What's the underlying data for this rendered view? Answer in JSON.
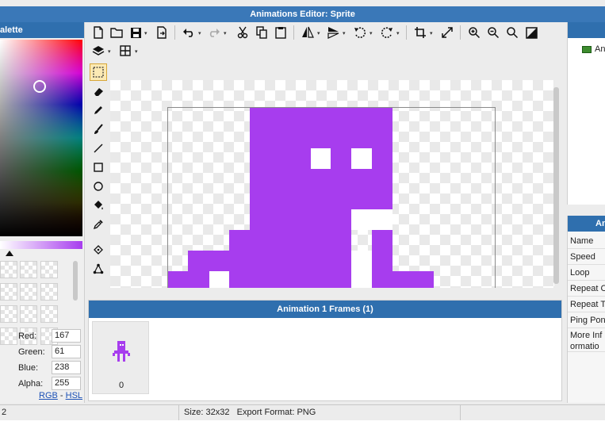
{
  "window": {
    "title": "Animations Editor: Sprite"
  },
  "palette": {
    "header": "alette",
    "color": {
      "red": "167",
      "green": "61",
      "blue": "238",
      "alpha": "255"
    },
    "labels": {
      "red": "Red:",
      "green": "Green:",
      "blue": "Blue:",
      "alpha": "Alpha:"
    },
    "modes": {
      "rgb": "RGB",
      "separator": " - ",
      "hsl": "HSL"
    },
    "current_color": "#a73dee"
  },
  "toolbar": {
    "icons": [
      "new-file-icon",
      "open-folder-icon",
      "save-icon",
      "export-icon",
      "undo-icon",
      "redo-icon",
      "cut-icon",
      "copy-icon",
      "paste-icon",
      "flip-horizontal-icon",
      "flip-vertical-icon",
      "rotate-left-icon",
      "rotate-right-icon",
      "crop-icon",
      "resize-icon",
      "zoom-in-icon",
      "zoom-out-icon",
      "zoom-fit-icon",
      "fill-screen-icon",
      "layers-icon",
      "grid-icon"
    ]
  },
  "tools": [
    "select-rectangle-icon",
    "eraser-icon",
    "pencil-icon",
    "brush-icon",
    "line-icon",
    "rectangle-icon",
    "ellipse-icon",
    "fill-bucket-icon",
    "eyedropper-icon",
    "point-icon",
    "node-icon"
  ],
  "frames": {
    "header": "Animation 1 Frames (1)",
    "items": [
      {
        "index": "0"
      }
    ]
  },
  "animations_list": {
    "items": [
      {
        "label": "An"
      }
    ]
  },
  "properties": {
    "header": "Anim",
    "rows": [
      "Name",
      "Speed",
      "Loop",
      "Repeat C",
      "Repeat To",
      "Ping Pong",
      "More Informatio"
    ]
  },
  "status": {
    "left": "2",
    "size": "Size: 32x32",
    "format": "Export Format: PNG"
  }
}
